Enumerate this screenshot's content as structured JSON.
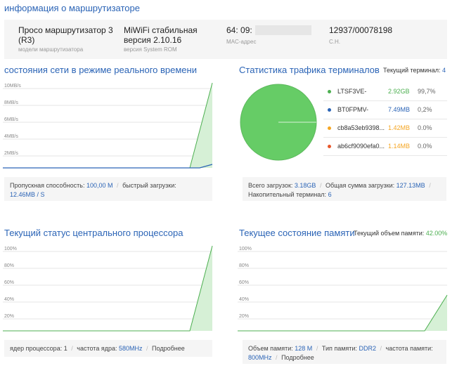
{
  "page_title": "информация о маршрутизаторе",
  "info": {
    "model_value": "Просо маршрутизатор 3 (R3)",
    "model_label": "модели маршрутизатора",
    "rom_value": "MiWiFi стабильная версия 2.10.16",
    "rom_label": "версия System ROM",
    "mac_value": "64: 09:",
    "mac_label": "MAC-адрес",
    "sn_value": "12937/00078198",
    "sn_label": "С.Н."
  },
  "network": {
    "title": "состояния сети в режиме реального времени",
    "y_ticks": [
      "10MB/s",
      "8MB/s",
      "6MB/s",
      "4MB/s",
      "2MB/s"
    ],
    "bandwidth_label": "Пропускная способность:",
    "bandwidth_value": "100,00 М",
    "download_label": "быстрый загрузки:",
    "download_value": "12.46MB / S"
  },
  "traffic": {
    "title": "Статистика трафика терминалов",
    "current_label": "Текущий терминал:",
    "current_value": "4",
    "terminals": [
      {
        "name": "LTSF3VE-",
        "size": "2.92GB",
        "pct": "99,7%",
        "color": "#4caf50"
      },
      {
        "name": "BT0FPMV-",
        "size": "7.49MB",
        "pct": "0,2%",
        "color": "#2b64b6"
      },
      {
        "name": "cb8a53eb9398...",
        "size": "1.42MB",
        "pct": "0.0%",
        "color": "#f5a623"
      },
      {
        "name": "ab6cf9090efa0...",
        "size": "1.14MB",
        "pct": "0.0%",
        "color": "#e8572b"
      }
    ],
    "total_label": "Всего загрузок:",
    "total_value": "3.18GB",
    "sum_label": "Общая сумма загрузки:",
    "sum_value": "127.13MB",
    "acc_label": "Накопительный терминал:",
    "acc_value": "6"
  },
  "cpu": {
    "title": "Текущий статус центрального процессора",
    "y_ticks": [
      "100%",
      "80%",
      "60%",
      "40%",
      "20%"
    ],
    "cores_label": "ядер процессора:",
    "cores_value": "1",
    "freq_label": "частота ядра:",
    "freq_value": "580MHz",
    "more": "Подробнее"
  },
  "memory": {
    "title": "Текущее состояние памяти",
    "current_label": "Текущий объем памяти:",
    "current_value": "42.00%",
    "y_ticks": [
      "100%",
      "80%",
      "60%",
      "40%",
      "20%"
    ],
    "size_label": "Объем памяти:",
    "size_value": "128 M",
    "type_label": "Тип памяти:",
    "type_value": "DDR2",
    "freq_label": "частота памяти:",
    "freq_value": "800MHz",
    "more": "Подробнее"
  },
  "colors": {
    "accent": "#2b64b6",
    "green": "#4caf50",
    "grid": "#e6e6e6"
  }
}
